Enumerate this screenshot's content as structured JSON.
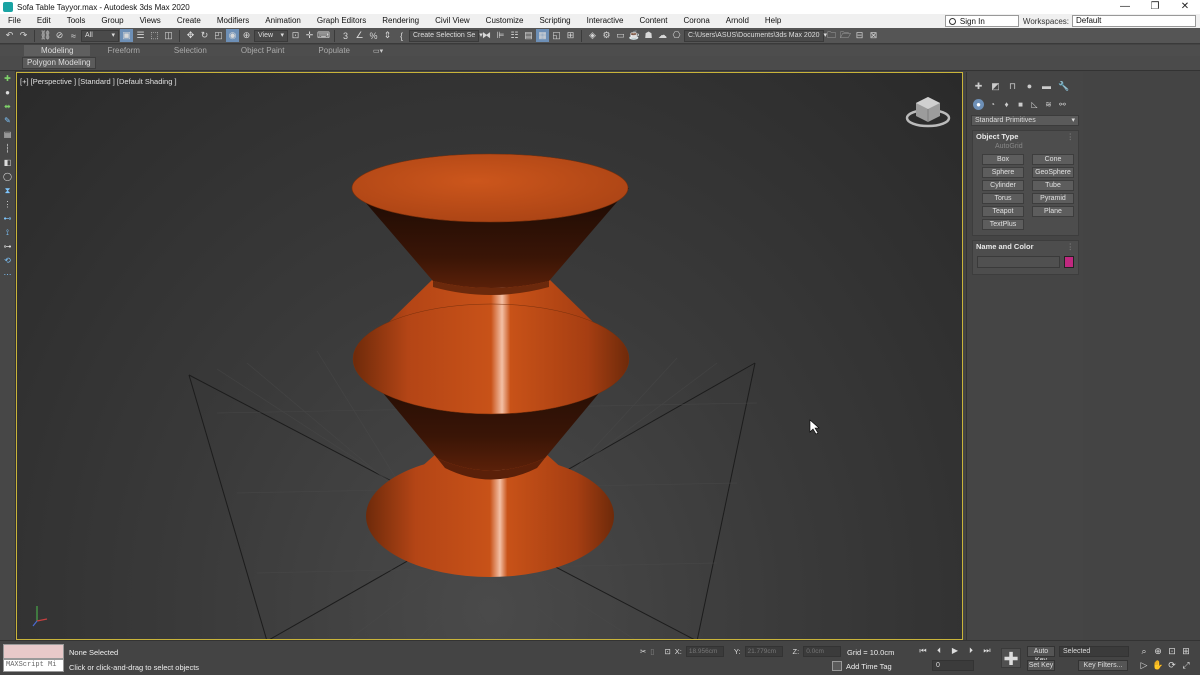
{
  "titlebar": {
    "title": "Sofa Table Tayyor.max - Autodesk 3ds Max 2020",
    "minimize": "—",
    "restore": "❐",
    "close": "✕"
  },
  "menubar": {
    "items": [
      "File",
      "Edit",
      "Tools",
      "Group",
      "Views",
      "Create",
      "Modifiers",
      "Animation",
      "Graph Editors",
      "Rendering",
      "Civil View",
      "Customize",
      "Scripting",
      "Interactive",
      "Content",
      "Corona",
      "Arnold",
      "Help"
    ],
    "sign_in": "Sign In",
    "workspace_label": "Workspaces:",
    "workspace_value": "Default"
  },
  "toolbar": {
    "selection_filter": "All",
    "view_dropdown": "View",
    "named_selection": "Create Selection Se",
    "project_path": "C:\\Users\\ASUS\\Documents\\3ds Max 2020",
    "dropdown_arrow": "▾"
  },
  "ribbon": {
    "tabs": [
      "Modeling",
      "Freeform",
      "Selection",
      "Object Paint",
      "Populate"
    ],
    "active_tab": "Modeling",
    "panel_label": "Polygon Modeling"
  },
  "viewport": {
    "label": "[+] [Perspective ] [Standard ] [Default Shading ]",
    "object_color": "#c8521a",
    "frame_color": "#c9b43a"
  },
  "command_panel": {
    "category": "Standard Primitives",
    "object_type": {
      "title": "Object Type",
      "autogrid": "AutoGrid",
      "buttons": [
        "Box",
        "Cone",
        "Sphere",
        "GeoSphere",
        "Cylinder",
        "Tube",
        "Torus",
        "Pyramid",
        "Teapot",
        "Plane",
        "TextPlus"
      ]
    },
    "name_and_color": {
      "title": "Name and Color",
      "color": "#c0287f"
    }
  },
  "statusbar": {
    "maxscript_label": "MAXScript Mi",
    "selection_status": "None Selected",
    "prompt": "Click or click-and-drag to select objects",
    "x_label": "X:",
    "x_value": "18.956cm",
    "y_label": "Y:",
    "y_value": "21.779cm",
    "z_label": "Z:",
    "z_value": "0.0cm",
    "grid": "Grid = 10.0cm",
    "add_time_tag": "Add Time Tag",
    "frame": "0",
    "auto_key": "Auto Key",
    "set_key": "Set Key",
    "key_mode": "Selected",
    "key_filters": "Key Filters..."
  }
}
